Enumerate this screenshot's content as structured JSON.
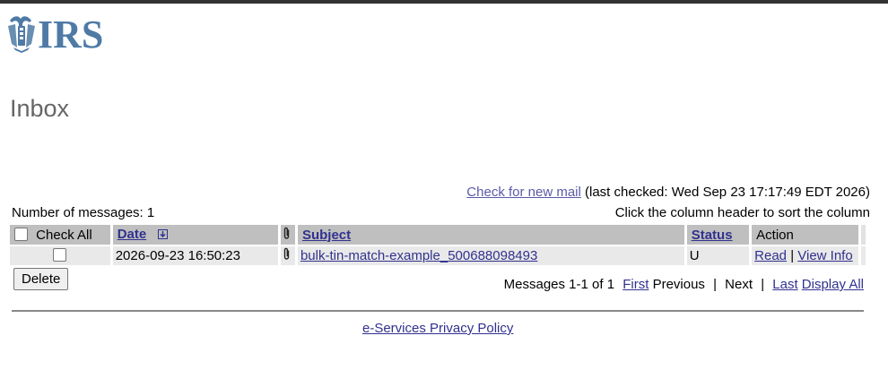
{
  "brand": {
    "logo_text": "IRS",
    "brand_color": "#4e7aa5"
  },
  "page": {
    "title": "Inbox"
  },
  "toolbar": {
    "check_mail_link": "Check for new mail",
    "last_checked": "(last checked: Wed Sep 23 17:17:49 EDT 2026)"
  },
  "summary": {
    "message_count": "Number of messages: 1",
    "sort_hint": "Click the column header to sort the column"
  },
  "table": {
    "headers": {
      "check_all": "Check All",
      "date": "Date",
      "subject": "Subject",
      "status": "Status",
      "action": "Action"
    },
    "rows": [
      {
        "date": "2026-09-23 16:50:23",
        "subject": "bulk-tin-match-example_500688098493",
        "status": "U",
        "read": "Read",
        "separator": "|",
        "view_info": "View Info"
      }
    ]
  },
  "actions": {
    "delete": "Delete"
  },
  "pager": {
    "range": "Messages 1-1 of 1",
    "first": "First",
    "previous": "Previous",
    "next": "Next",
    "last": "Last",
    "display_all": "Display All",
    "sep": "|"
  },
  "footer": {
    "privacy_link": "e-Services Privacy Policy"
  },
  "icons": {
    "sort": "sort-icon",
    "attachment": "paperclip-icon"
  }
}
